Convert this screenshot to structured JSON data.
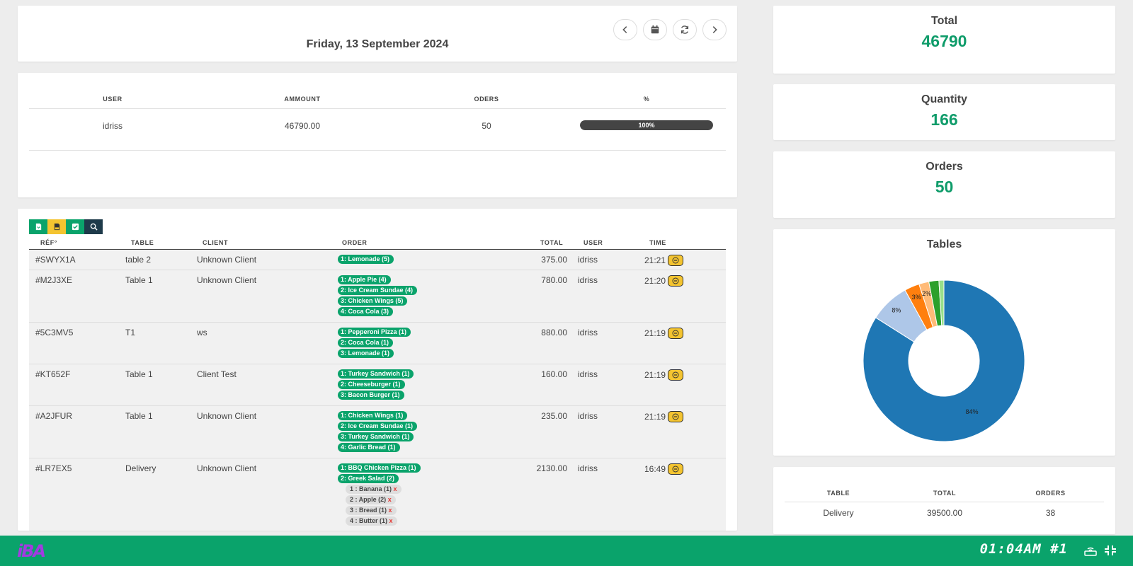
{
  "header": {
    "date": "Friday, 13 September 2024",
    "nav_icons": [
      "chevron-left-icon",
      "calendar-icon",
      "refresh-icon",
      "chevron-right-icon"
    ]
  },
  "user_table": {
    "headers": [
      "USER",
      "AMMOUNT",
      "ODERS",
      "%"
    ],
    "rows": [
      {
        "user": "idriss",
        "amount": "46790.00",
        "orders": "50",
        "percent": "100%",
        "progress": 1.0
      }
    ]
  },
  "orders_table": {
    "toolbar_icons": [
      "file-icon",
      "pdf-icon",
      "check-icon",
      "search-icon"
    ],
    "toolbar_colors": [
      "#0aa36b",
      "#f4c430",
      "#0aa36b",
      "#1e3a4a"
    ],
    "headers": [
      "RÉF°",
      "TABLE",
      "CLIENT",
      "ORDER",
      "TOTAL",
      "USER",
      "TIME"
    ],
    "rows": [
      {
        "ref": "#SWYX1A",
        "table": "table 2",
        "client": "Unknown Client",
        "items": [
          "1: Lemonade (5)"
        ],
        "subs": [],
        "total": "375.00",
        "user": "idriss",
        "time": "21:21"
      },
      {
        "ref": "#M2J3XE",
        "table": "Table 1",
        "client": "Unknown Client",
        "items": [
          "1: Apple Pie (4)",
          "2: Ice Cream Sundae (4)",
          "3: Chicken Wings (5)",
          "4: Coca Cola (3)"
        ],
        "subs": [],
        "total": "780.00",
        "user": "idriss",
        "time": "21:20"
      },
      {
        "ref": "#5C3MV5",
        "table": "T1",
        "client": "ws",
        "items": [
          "1: Pepperoni Pizza (1)",
          "2: Coca Cola (1)",
          "3: Lemonade (1)"
        ],
        "subs": [],
        "total": "880.00",
        "user": "idriss",
        "time": "21:19"
      },
      {
        "ref": "#KT652F",
        "table": "Table 1",
        "client": "Client Test",
        "items": [
          "1: Turkey Sandwich (1)",
          "2: Cheeseburger (1)",
          "3: Bacon Burger (1)"
        ],
        "subs": [],
        "total": "160.00",
        "user": "idriss",
        "time": "21:19"
      },
      {
        "ref": "#A2JFUR",
        "table": "Table 1",
        "client": "Unknown Client",
        "items": [
          "1: Chicken Wings (1)",
          "2: Ice Cream Sundae (1)",
          "3: Turkey Sandwich (1)",
          "4: Garlic Bread (1)"
        ],
        "subs": [],
        "total": "235.00",
        "user": "idriss",
        "time": "21:19"
      },
      {
        "ref": "#LR7EX5",
        "table": "Delivery",
        "client": "Unknown Client",
        "items": [
          "1: BBQ Chicken Pizza (1)",
          "2: Greek Salad (2)"
        ],
        "subs": [
          "1 : Banana (1)",
          "2 : Apple (2)",
          "3 : Bread (1)",
          "4 : Butter (1)"
        ],
        "sub_remove": "x",
        "total": "2130.00",
        "user": "idriss",
        "time": "16:49"
      }
    ]
  },
  "stats": {
    "total_label": "Total",
    "total_value": "46790",
    "quantity_label": "Quantity",
    "quantity_value": "166",
    "orders_label": "Orders",
    "orders_value": "50"
  },
  "tables_chart_title": "Tables",
  "chart_data": {
    "type": "pie",
    "donut": true,
    "title": "Tables",
    "slices": [
      {
        "label": "84%",
        "value": 84,
        "color": "#1f77b4"
      },
      {
        "label": "8%",
        "value": 8,
        "color": "#aec7e8"
      },
      {
        "label": "3%",
        "value": 3,
        "color": "#ff7f0e"
      },
      {
        "label": "2%",
        "value": 2,
        "color": "#ffbb78"
      },
      {
        "label": "",
        "value": 2,
        "color": "#2ca02c"
      },
      {
        "label": "",
        "value": 1,
        "color": "#98df8a"
      }
    ]
  },
  "tables_list": {
    "headers": [
      "TABLE",
      "TOTAL",
      "ORDERS"
    ],
    "rows": [
      {
        "table": "Delivery",
        "total": "39500.00",
        "orders": "38"
      }
    ]
  },
  "bottom_bar": {
    "logo": "iBA",
    "clock": "01:04AM #1",
    "icons": [
      "router-icon",
      "compress-icon"
    ]
  }
}
